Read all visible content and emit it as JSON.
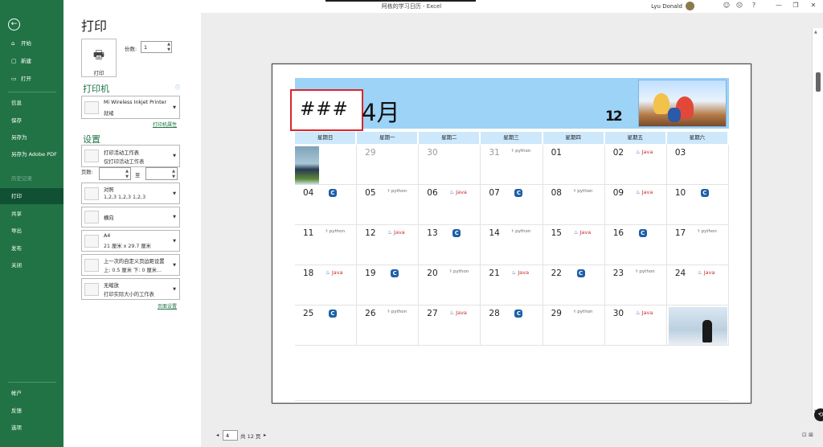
{
  "window": {
    "title": "阿栋的学习日历 - Excel",
    "user": "Lyu Donald"
  },
  "titlebar_icons": [
    "smiley-icon",
    "sad-icon",
    "help-icon",
    "minimize-icon",
    "restore-icon",
    "close-icon"
  ],
  "nav": {
    "items": [
      "开始",
      "新建",
      "打开",
      "信息",
      "保存",
      "另存为",
      "另存为 Adobe PDF",
      "历史记录",
      "打印",
      "共享",
      "导出",
      "发布",
      "关闭"
    ],
    "bottom": [
      "帐户",
      "反馈",
      "选项"
    ],
    "selected": "打印"
  },
  "print": {
    "title": "打印",
    "button_label": "打印",
    "copies_label": "份数:",
    "copies_value": "1",
    "printer_section": "打印机",
    "printer_name": "Mi Wireless Inkjet Printer",
    "printer_status": "就绪",
    "printer_props": "打印机属性",
    "settings_section": "设置",
    "what": {
      "l1": "打印活动工作表",
      "l2": "仅打印活动工作表"
    },
    "pages_label": "页数:",
    "pages_to": "至",
    "collate": {
      "l1": "对照",
      "l2": "1,2,3    1,2,3    1,2,3"
    },
    "orientation": "横向",
    "paper": {
      "l1": "A4",
      "l2": "21 厘米 x 29.7 厘米"
    },
    "margins": {
      "l1": "上一次的自定义页边距设置",
      "l2": "上: 0.5 厘米 下: 0 厘米..."
    },
    "scaling": {
      "l1": "无缩放",
      "l2": "打印实际大小的工作表"
    },
    "page_setup": "页面设置"
  },
  "calendar": {
    "year": "###",
    "month": "4月",
    "logo": "12",
    "weekdays": [
      "星期日",
      "星期一",
      "星期二",
      "星期三",
      "星期四",
      "星期五",
      "星期六"
    ],
    "rows": [
      [
        {
          "d": "",
          "img": "motorbike"
        },
        {
          "d": "29",
          "prev": true
        },
        {
          "d": "30",
          "prev": true
        },
        {
          "d": "31",
          "prev": true,
          "b": "python"
        },
        {
          "d": "01"
        },
        {
          "d": "02",
          "b": "java"
        },
        {
          "d": "03"
        }
      ],
      [
        {
          "d": "04",
          "b": "c"
        },
        {
          "d": "05",
          "b": "python"
        },
        {
          "d": "06",
          "b": "java"
        },
        {
          "d": "07",
          "b": "c"
        },
        {
          "d": "08",
          "b": "python"
        },
        {
          "d": "09",
          "b": "java"
        },
        {
          "d": "10",
          "b": "c"
        }
      ],
      [
        {
          "d": "11",
          "b": "python"
        },
        {
          "d": "12",
          "b": "java"
        },
        {
          "d": "13",
          "b": "c"
        },
        {
          "d": "14",
          "b": "python"
        },
        {
          "d": "15",
          "b": "java"
        },
        {
          "d": "16",
          "b": "c"
        },
        {
          "d": "17",
          "b": "python"
        }
      ],
      [
        {
          "d": "18",
          "b": "java"
        },
        {
          "d": "19",
          "b": "c"
        },
        {
          "d": "20",
          "b": "python"
        },
        {
          "d": "21",
          "b": "java"
        },
        {
          "d": "22",
          "b": "c"
        },
        {
          "d": "23",
          "b": "python"
        },
        {
          "d": "24",
          "b": "java"
        }
      ],
      [
        {
          "d": "25",
          "b": "c"
        },
        {
          "d": "26",
          "b": "python"
        },
        {
          "d": "27",
          "b": "java"
        },
        {
          "d": "28",
          "b": "c"
        },
        {
          "d": "29",
          "b": "python"
        },
        {
          "d": "30",
          "b": "java"
        },
        {
          "d": "",
          "img": "person"
        }
      ]
    ],
    "badge_text": {
      "java": "Java",
      "python": "python",
      "c": "C"
    }
  },
  "pager": {
    "current": "4",
    "total": "共 12 页"
  },
  "colors": {
    "excel_green": "#217346",
    "banner": "#9cd3f7",
    "highlight": "#d9262c"
  }
}
